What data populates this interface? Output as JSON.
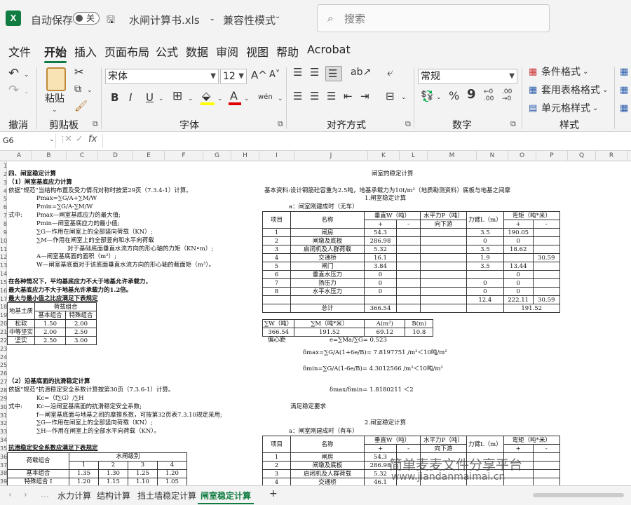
{
  "titlebar": {
    "autosave": "自动保存",
    "toggle": "关",
    "filename": "水闸计算书.xls",
    "separator": "-",
    "mode": "兼容性模式",
    "search_placeholder": "搜索"
  },
  "menu": [
    "文件",
    "开始",
    "插入",
    "页面布局",
    "公式",
    "数据",
    "审阅",
    "视图",
    "帮助",
    "Acrobat"
  ],
  "ribbon": {
    "undo_group": "撤消",
    "paste": "粘贴",
    "clipboard": "剪贴板",
    "font_name": "宋体",
    "font_size": "12",
    "font_group": "字体",
    "bold": "B",
    "italic": "I",
    "underline": "U",
    "align_group": "对齐方式",
    "number_format": "常规",
    "number_group": "数字",
    "cond_format": "条件格式",
    "table_format": "套用表格格式",
    "cell_style": "单元格样式",
    "style_group": "样式",
    "grow": "A^",
    "shrink": "A˅",
    "wen": "wén",
    "percent": "%",
    "comma": "9",
    "dec_inc": "←0 .00",
    "dec_dec": ".00 →0",
    "A": "A",
    "fx": "fx"
  },
  "formula": {
    "namebox": "G6",
    "value": ""
  },
  "columns": [
    "A",
    "B",
    "C",
    "D",
    "E",
    "F",
    "G",
    "H",
    "I",
    "J",
    "K",
    "L",
    "M",
    "N",
    "O",
    "P",
    "Q",
    "R",
    "S"
  ],
  "rows": [
    "1",
    "2",
    "3",
    "4",
    "5",
    "6",
    "7",
    "8",
    "9",
    "10",
    "11",
    "12",
    "13",
    "14",
    "15",
    "16",
    "17",
    "18",
    "19",
    "20",
    "21",
    "22",
    "23",
    "24",
    "25",
    "26",
    "27",
    "28",
    "29",
    "30",
    "31",
    "32",
    "33",
    "34",
    "35",
    "36",
    "37",
    "38",
    "39"
  ],
  "left": {
    "r2": "四、闸室稳定计算",
    "r3": "（1）闸室基底应力计算",
    "r4": "依据“规范”当结构布置及受力情况对称时按第29页（7.3.4-1）计算。",
    "r5": "Pmax=∑G/A+∑M/W",
    "r6": "Pmin=∑G/A-∑M/W",
    "r7a": "式中:",
    "r7": "Pmax—闸室基底应力的最大值;",
    "r8": "Pmin—闸室基底应力的最小值;",
    "r9": "∑G—作用在闸室上的全部竖向荷载（KN）;",
    "r10": "∑M—作用在闸室上的全部竖向和水平向荷载",
    "r11": "对于基础底面垂直水流方向的形心轴的力矩（KN•m）;",
    "r12": "A—闸室基底面的面积（m²）;",
    "r13": "W—闸室基底面对于该底面垂直水流方向的形心轴的截面矩（m³）。",
    "r15": "在各种情况下，平均基底应力不大于地基允许承载力，",
    "r16": "最大基底应力不大于地基允许承载力的1.2倍。",
    "r17": "最大与最小值之比应满足下表规定",
    "t1_h1": "地基土质",
    "t1_h2": "荷载组合",
    "t1_h3": "基本组合",
    "t1_h4": "特殊组合",
    "t1_rows": [
      [
        "松软",
        "1.50",
        "2.00"
      ],
      [
        "中等坚实",
        "2.00",
        "2.50"
      ],
      [
        "坚实",
        "2.50",
        "3.00"
      ]
    ],
    "r27": "（2）沿基底面的抗滑稳定计算",
    "r28": "依据“规范”抗滑稳定安全系数计算按第30页（7.3.6-1）计算。",
    "r29": "Kc=（f∑G）/∑H",
    "r30a": "式中:",
    "r30": "Kc—沿闸室基底面的抗滑稳定安全系数;",
    "r31": "f—闸室基底面与地基之间的摩擦系数，可按第32页表7.3.10规定采用;",
    "r32": "∑G—作用在闸室上的全部竖向荷载（KN）;",
    "r33": "∑H—作用在闸室上的全部水平向荷载（KN）。",
    "r35": "抗滑稳定安全系数应满足下表规定",
    "t2_h1": "荷载组合",
    "t2_h2": "水闸级别",
    "t2_levels": [
      "1",
      "2",
      "3",
      "4"
    ],
    "t2_rows": [
      [
        "基本组合",
        "1.35",
        "1.30",
        "1.25",
        "1.20"
      ],
      [
        "特殊组合",
        "1.20",
        "1.15",
        "1.10",
        "1.05"
      ]
    ],
    "t2_row2_mark": "Ⅰ"
  },
  "right": {
    "title": "闸室的稳定计算",
    "basis": "基本资料:设计钢筋砼容重为2.5吨，地基承载力为10t/m²（地质勘测资料）底板与地基之间摩",
    "sub1": "1.闸室稳定计算",
    "case_a": "a：闸室刚建成时（无车）",
    "hdr": [
      "项目",
      "名称",
      "垂直W（吨）",
      "水平力P（吨）",
      "力臂L（m）",
      "弯矩（吨*米）"
    ],
    "hdr2": [
      "+",
      "-",
      "向下游",
      "+",
      "-"
    ],
    "rows1": [
      [
        "1",
        "闸房",
        "54.3",
        "",
        "",
        "3.5",
        "190.05",
        ""
      ],
      [
        "2",
        "闸墩及底板",
        "286.98",
        "",
        "",
        "0",
        "0",
        ""
      ],
      [
        "3",
        "启闭机及人群荷载",
        "5.32",
        "",
        "",
        "3.5",
        "18.62",
        ""
      ],
      [
        "4",
        "交通桥",
        "16.1",
        "",
        "",
        "1.9",
        "",
        "30.59"
      ],
      [
        "5",
        "闸门",
        "3.84",
        "",
        "",
        "3.5",
        "13.44",
        ""
      ],
      [
        "6",
        "垂直水压力",
        "0",
        "",
        "",
        "",
        "0",
        ""
      ],
      [
        "7",
        "扬压力",
        "0",
        "",
        "",
        "0",
        "0",
        ""
      ],
      [
        "8",
        "水平水压力",
        "0",
        "",
        "",
        "0",
        "0",
        ""
      ],
      [
        "",
        "",
        "",
        "",
        "",
        "12.4",
        "222.11",
        "30.59"
      ]
    ],
    "total_label": "总计",
    "total_w": "366.54",
    "total_m": "191.52",
    "sum_hdr": [
      "∑W（吨）",
      "∑M（吨*米）",
      "A(m²)",
      "B(m)"
    ],
    "sum_vals": [
      "366.54",
      "191.52",
      "69.12",
      "10.8"
    ],
    "ecc_label": "偏心距",
    "ecc": "e=∑Ma/∑G= 0.523",
    "dmax": "δmax=∑G/A(1+6e/B)= 7.8197751 /m²＜10吨/m²",
    "dmin": "δmin=∑G/A(1-6e/B)= 4.3012566 /m²＜10吨/m²",
    "ratio": "δmax/δmin= 1.8180211 ＜2",
    "ok": "满足稳定要求",
    "sub2": "2.闸室稳定计算",
    "case_b": "a：闸室刚建成时（有车）",
    "rows2": [
      [
        "1",
        "闸房",
        "54.3"
      ],
      [
        "2",
        "闸墩及底板",
        "286.98"
      ],
      [
        "3",
        "启闭机及人群荷载",
        "5.32"
      ],
      [
        "4",
        "交通桥",
        "46.1"
      ]
    ]
  },
  "tabs": [
    "水力计算",
    "结构计算",
    "挡土墙稳定计算",
    "闸室稳定计算"
  ],
  "tabs_add": "+",
  "watermark": {
    "line1": "简单麦麦文件分享平台",
    "line2": "www.jiandanmaimai.cn"
  }
}
